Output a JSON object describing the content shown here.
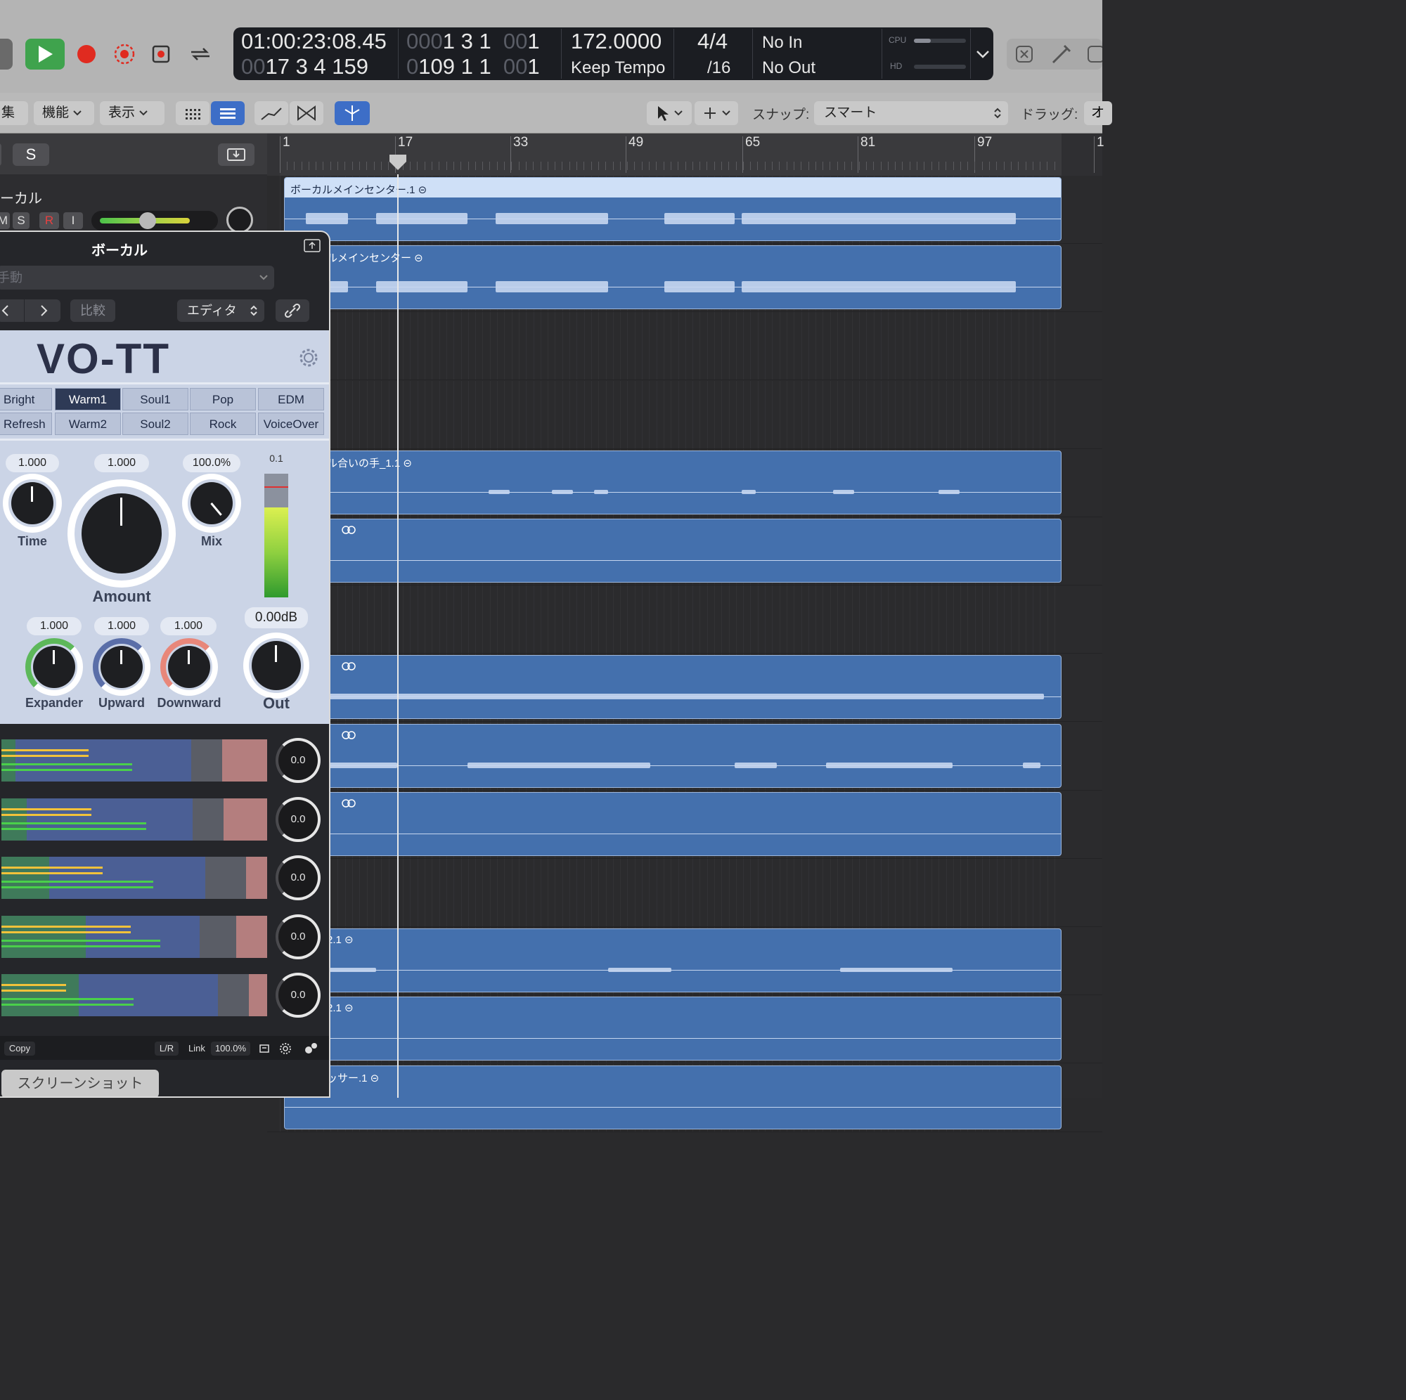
{
  "transport": {
    "timecode": "01:00:23:08.45",
    "bars_position_dim": "000",
    "bars_position": "1  3  1",
    "bars_position_sub_dim": "00",
    "bars_position_sub": "1",
    "bars_secondary_dim": "00",
    "bars_secondary": "17  3  4  159",
    "bars_end_dim": "0",
    "bars_end": "109  1  1",
    "bars_end_sub_dim": "00",
    "bars_end_sub": "1",
    "tempo": "172.0000",
    "tempo_mode": "Keep Tempo",
    "time_signature": "4/4",
    "division": "/16",
    "in_port": "No In",
    "out_port": "No Out",
    "cpu_label": "CPU",
    "hd_label": "HD"
  },
  "toolbar": {
    "edit_menu_partial": "集",
    "functions_menu": "機能",
    "view_menu": "表示",
    "snap_label": "スナップ:",
    "snap_value": "スマート",
    "drag_label": "ドラッグ:",
    "drag_value_partial": "オ"
  },
  "track_header": {
    "solo_label": "S",
    "track_name_partial": "ーカル",
    "m_label": "M",
    "s_label": "S",
    "r_label": "R",
    "i_label": "I"
  },
  "ruler": {
    "marks": [
      "1",
      "17",
      "33",
      "49",
      "65",
      "81",
      "97",
      "1"
    ]
  },
  "regions": [
    {
      "name": "ボーカルメインセンター.1"
    },
    {
      "name": "ルメインセンター"
    },
    {
      "name": "ル合いの手_1.1"
    },
    {
      "name": ""
    },
    {
      "name": ""
    },
    {
      "name": ""
    },
    {
      "name": ""
    },
    {
      "name": "2.1"
    },
    {
      "name": "2.1"
    },
    {
      "name": "ッサー.1"
    }
  ],
  "plugin": {
    "window_title": "ボーカル",
    "preset_menu": "手動",
    "compare_label": "比較",
    "editor_label": "エディタ",
    "logo": "VO-TT",
    "presets": [
      "Bright",
      "Warm1",
      "Soul1",
      "Pop",
      "EDM",
      "Refresh",
      "Warm2",
      "Soul2",
      "Rock",
      "VoiceOver"
    ],
    "selected_preset": "Warm1",
    "time_value": "1.000",
    "time_label": "Time",
    "amount_value": "1.000",
    "amount_label": "Amount",
    "mix_value": "100.0%",
    "mix_label": "Mix",
    "meter_peak": "0.1",
    "out_value": "0.00dB",
    "out_label": "Out",
    "expander_value": "1.000",
    "expander_label": "Expander",
    "upward_value": "1.000",
    "upward_label": "Upward",
    "downward_value": "1.000",
    "downward_label": "Downward",
    "band_values": [
      "0.0",
      "0.0",
      "0.0",
      "0.0",
      "0.0"
    ],
    "footer_copy": "Copy",
    "footer_lr": "L/R",
    "footer_link": "Link",
    "footer_link_value": "100.0%",
    "screenshot_button": "スクリーンショット"
  },
  "colors": {
    "play_green": "#3fa34d",
    "record_red": "#e02b20",
    "region_blue": "#4470ad",
    "selected_region_header": "#cfe0f7",
    "plugin_bg": "#cbd4e6"
  }
}
